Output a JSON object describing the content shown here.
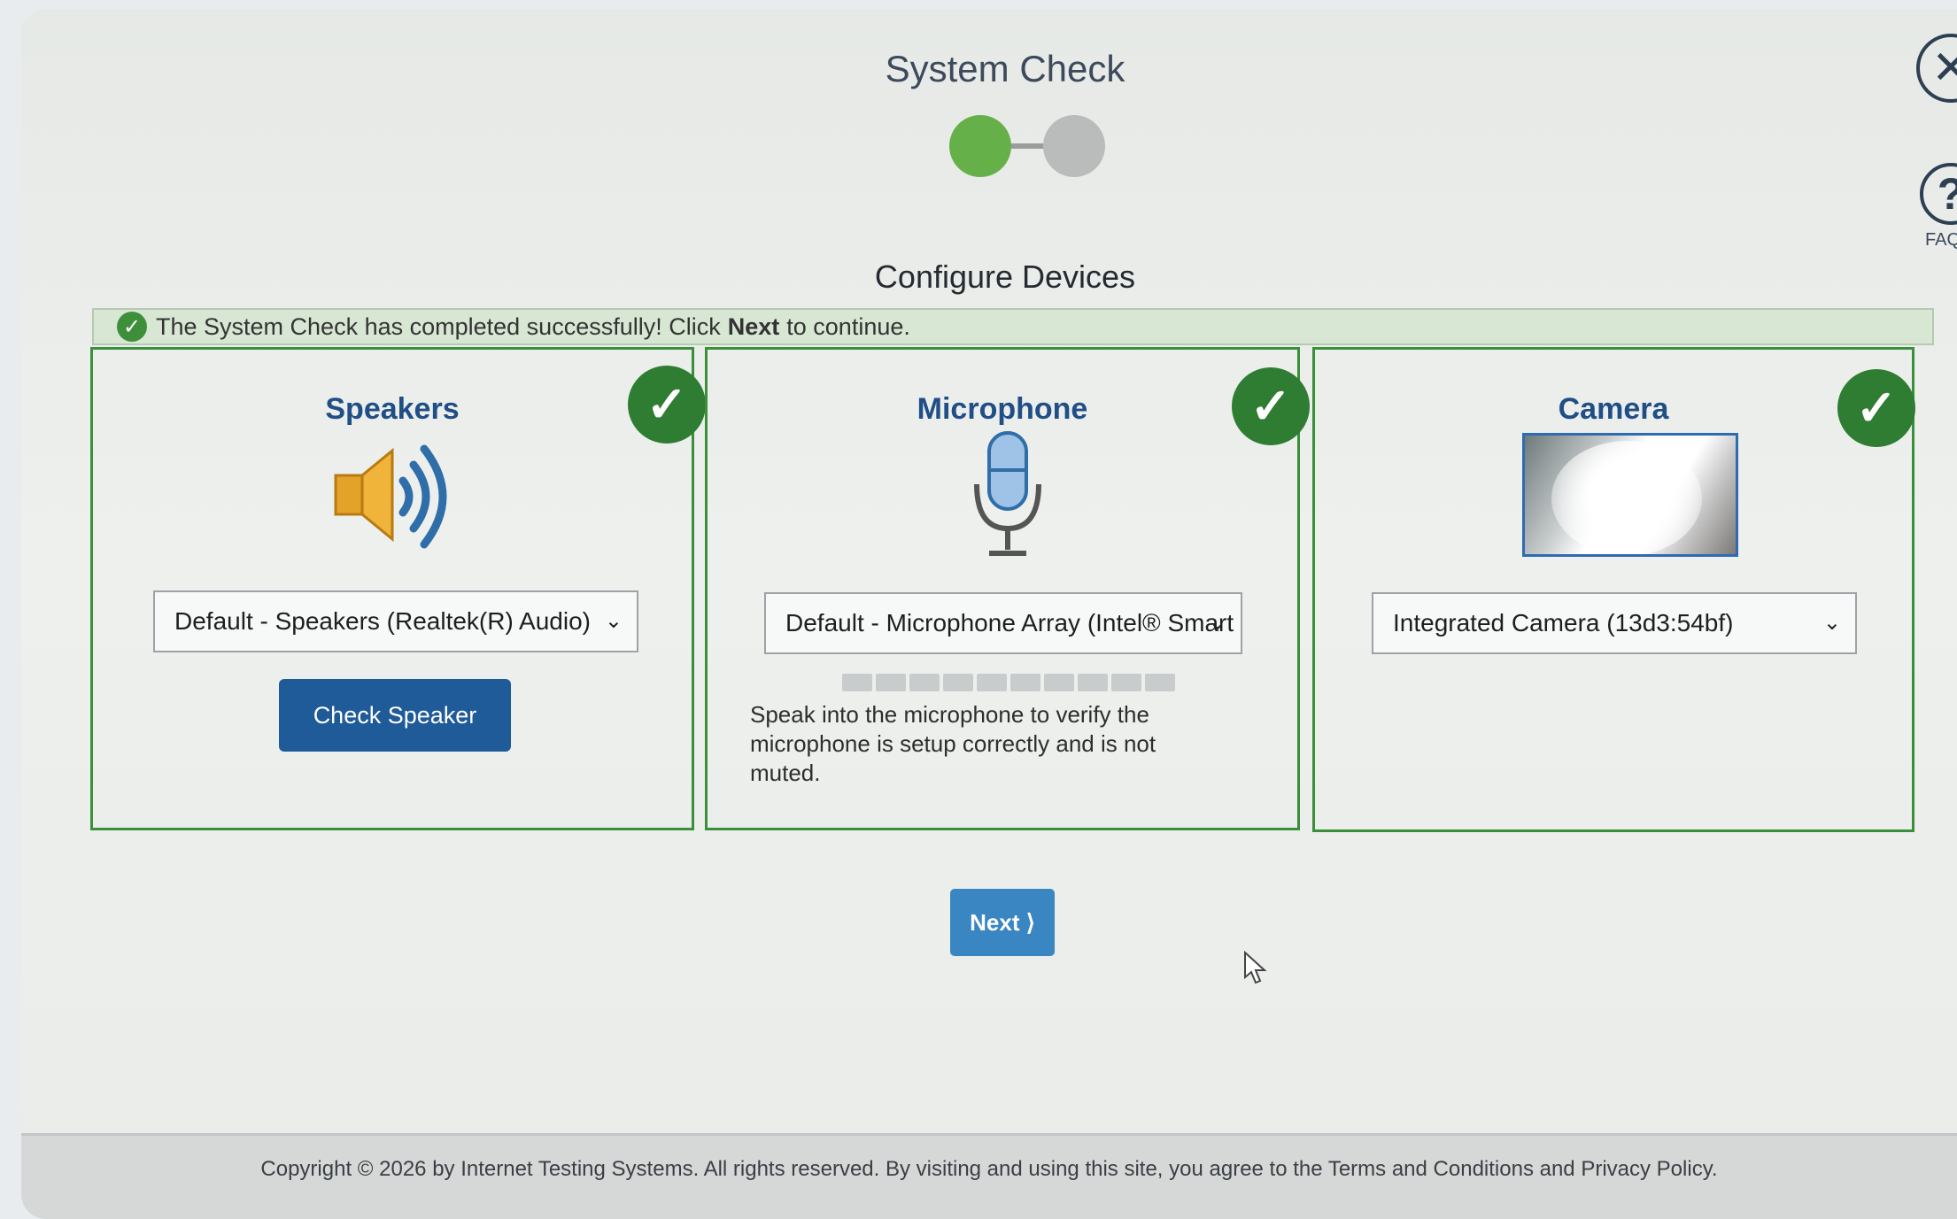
{
  "page": {
    "title": "System Check",
    "subtitle": "Configure Devices",
    "steps": [
      "step-1",
      "step-2"
    ],
    "current_step": 1
  },
  "header": {
    "close_icon": "close-icon",
    "faq_icon": "help-icon",
    "faq_label": "FAQ"
  },
  "banner": {
    "prefix": "The System Check has completed successfully! Click",
    "strong": "Next",
    "suffix": "to continue."
  },
  "panels": {
    "speakers": {
      "title": "Speakers",
      "device": "Default - Speakers (Realtek(R) Audio)",
      "button": "Check Speaker",
      "status": "ok"
    },
    "microphone": {
      "title": "Microphone",
      "device": "Default - Microphone Array (Intel® Smart",
      "help": "Speak into the microphone to verify the microphone is setup correctly and is not muted.",
      "meter_level": 0,
      "meter_segments": 10,
      "status": "ok"
    },
    "camera": {
      "title": "Camera",
      "device": "Integrated Camera (13d3:54bf)",
      "status": "ok"
    }
  },
  "actions": {
    "next": "Next ⟩"
  },
  "footer": {
    "text": "Copyright © 2026 by Internet Testing Systems. All rights reserved. By visiting and using this site, you agree to the Terms and Conditions and Privacy Policy."
  },
  "colors": {
    "success": "#2e7d32",
    "primary_button": "#1f5a99",
    "next_button": "#3a86c3",
    "panel_border": "#3a8f3a",
    "title": "#204e86"
  }
}
